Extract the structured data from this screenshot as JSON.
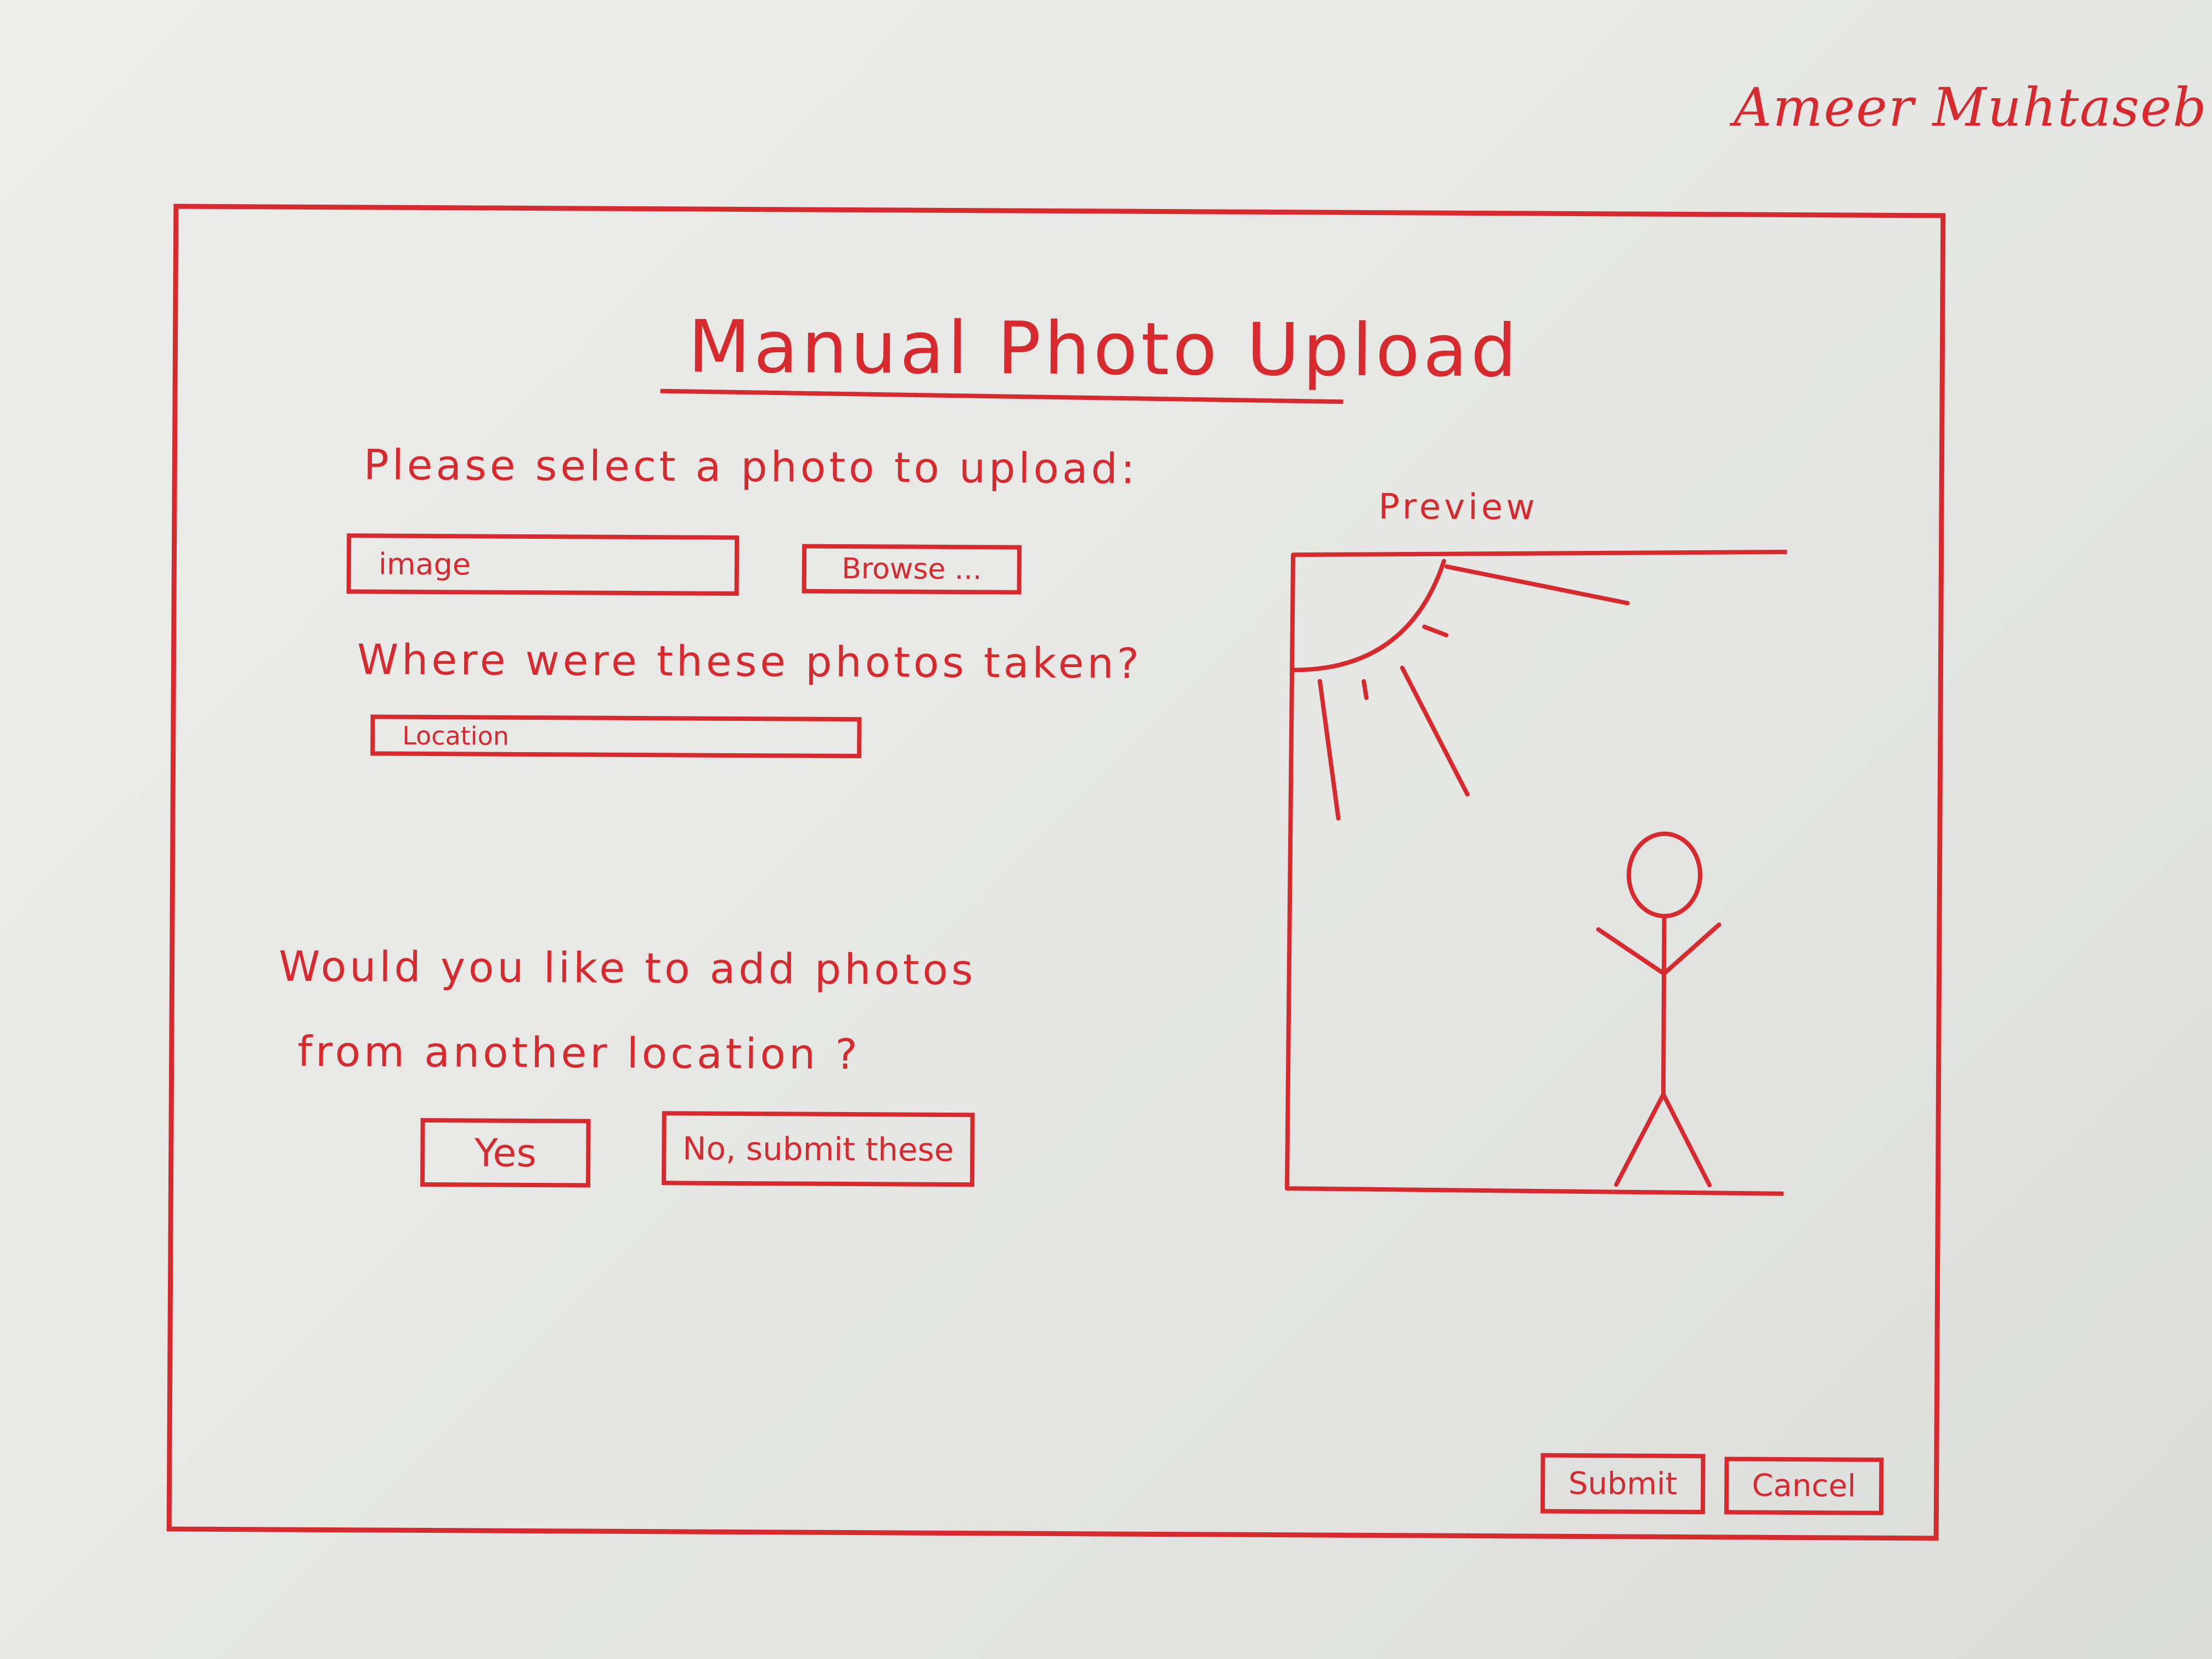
{
  "author": "Ameer Muhtaseb",
  "dialog": {
    "title": "Manual Photo Upload"
  },
  "upload": {
    "prompt": "Please select a photo to upload:",
    "image_placeholder": "image",
    "browse_label": "Browse ..."
  },
  "location": {
    "prompt": "Where were these photos taken?",
    "placeholder": "Location"
  },
  "more": {
    "prompt_line1": "Would you like to add photos",
    "prompt_line2": "from another location ?",
    "yes_label": "Yes",
    "no_label": "No, submit these"
  },
  "preview": {
    "label": "Preview",
    "content_icon": "sun-and-stick-figure-sketch"
  },
  "footer": {
    "submit_label": "Submit",
    "cancel_label": "Cancel"
  },
  "colors": {
    "ink": "#d72a2f",
    "paper": "#e6e7e4"
  }
}
